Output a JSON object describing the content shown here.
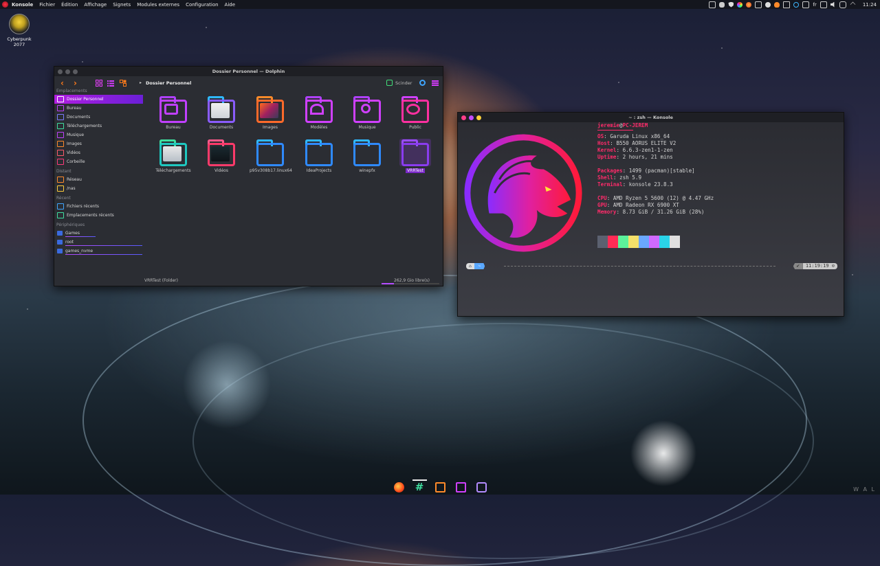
{
  "top_panel": {
    "menu": [
      "Konsole",
      "Fichier",
      "Édition",
      "Affichage",
      "Signets",
      "Modules externes",
      "Configuration",
      "Aide"
    ],
    "tray_lang": "fr",
    "clock": "11:24"
  },
  "desktop_icon": {
    "label": "Cyberpunk 2077"
  },
  "dolphin": {
    "title": "Dossier Personnel — Dolphin",
    "breadcrumb": "Dossier Personnel",
    "split_label": "Scinder",
    "sections": {
      "places": "Emplacements",
      "remote": "Distant",
      "recent": "Récent",
      "devices": "Périphériques"
    },
    "places": [
      "Dossier Personnel",
      "Bureau",
      "Documents",
      "Téléchargements",
      "Musique",
      "Images",
      "Vidéos",
      "Corbeille"
    ],
    "remote": [
      "Réseau",
      "/nas"
    ],
    "recent": [
      "Fichiers récents",
      "Emplacements récents"
    ],
    "devices": [
      "Games",
      "root",
      "games_nvme"
    ],
    "items": [
      "Bureau",
      "Documents",
      "Images",
      "Modèles",
      "Musique",
      "Public",
      "Téléchargements",
      "Vidéos",
      "p95v308b17.linux64",
      "IdeaProjects",
      "winepfx",
      "VRRTest"
    ],
    "status_left": "VRRTest (Folder)",
    "status_right": "262,9 Gio libre(s)"
  },
  "konsole": {
    "title": "~ : zsh — Konsole",
    "user": "jeremie",
    "at": "@",
    "host": "PC-JEREM",
    "info": [
      {
        "k": "OS",
        "v": "Garuda Linux x86_64"
      },
      {
        "k": "Host",
        "v": "B550 AORUS ELITE V2"
      },
      {
        "k": "Kernel",
        "v": "6.6.3-zen1-1-zen"
      },
      {
        "k": "Uptime",
        "v": "2 hours, 21 mins"
      },
      {
        "k": "Packages",
        "v": "1499 (pacman)[stable]"
      },
      {
        "k": "Shell",
        "v": "zsh 5.9"
      },
      {
        "k": "Terminal",
        "v": "konsole 23.8.3"
      },
      {
        "k": "CPU",
        "v": "AMD Ryzen 5 5600 (12) @ 4.47 GHz"
      },
      {
        "k": "GPU",
        "v": "AMD Radeon RX 6900 XT"
      },
      {
        "k": "Memory",
        "v": "8.73 GiB / 31.26 GiB (28%)"
      }
    ],
    "swatch_colors": [
      "#5b6170",
      "#ff2b55",
      "#5cf29a",
      "#f4e06a",
      "#6aa8ff",
      "#d06aff",
      "#2ad3e8",
      "#e0e0e0"
    ],
    "prompt_seg1": "⌂",
    "prompt_seg2": "~",
    "prompt_ok": "✔",
    "prompt_time": "11:19:19 ⊙"
  },
  "watermark": "W A L"
}
